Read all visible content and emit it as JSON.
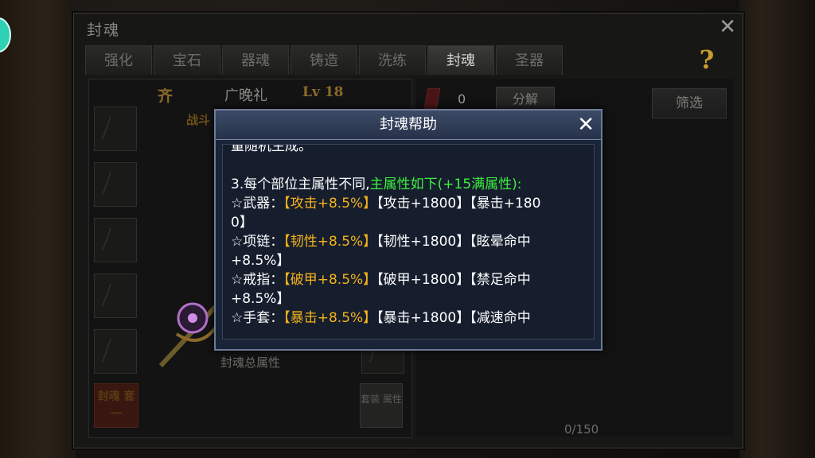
{
  "window": {
    "title": "封魂",
    "close_glyph": "✕",
    "help_glyph": "?",
    "tabs": [
      {
        "label": "强化",
        "active": false
      },
      {
        "label": "宝石",
        "active": false
      },
      {
        "label": "器魂",
        "active": false
      },
      {
        "label": "铸造",
        "active": false
      },
      {
        "label": "洗练",
        "active": false
      },
      {
        "label": "封魂",
        "active": true
      },
      {
        "label": "圣器",
        "active": false
      }
    ]
  },
  "hero": {
    "set_tag": "齐",
    "name": "广晚礼",
    "level": "Lv 18",
    "power_label": "战斗"
  },
  "left_panel": {
    "total_attr_label": "封魂总属性",
    "set_button_label": "封魂 套一",
    "set_attr_button_label": "套装 属性"
  },
  "right_panel": {
    "gem_count": "0",
    "decompose_label": "分解",
    "filter_label": "筛选",
    "capacity": "0/150"
  },
  "modal": {
    "title": "封魂帮助",
    "close_glyph": "✕",
    "lines": {
      "l0": "量随机生成。",
      "l1_a": "3.每个部位主属性不同,",
      "l1_b": "主属性如下(+15满属性):",
      "l2_a": "☆武器：",
      "l2_b": "【攻击+8.5%】",
      "l2_c": "【攻击+1800】【暴击+180",
      "l3": "0】",
      "l4_a": "☆项链：",
      "l4_b": "【韧性+8.5%】",
      "l4_c": "【韧性+1800】【眩晕命中",
      "l5": "+8.5%】",
      "l6_a": "☆戒指：",
      "l6_b": "【破甲+8.5%】",
      "l6_c": "【破甲+1800】【禁足命中",
      "l7": "+8.5%】",
      "l8_a": "☆手套：",
      "l8_b": "【暴击+8.5%】",
      "l8_c": "【暴击+1800】【减速命中"
    }
  },
  "colors": {
    "highlight_green": "#3df03d",
    "highlight_gold": "#f5b21a",
    "modal_bg": "#1a2438"
  }
}
